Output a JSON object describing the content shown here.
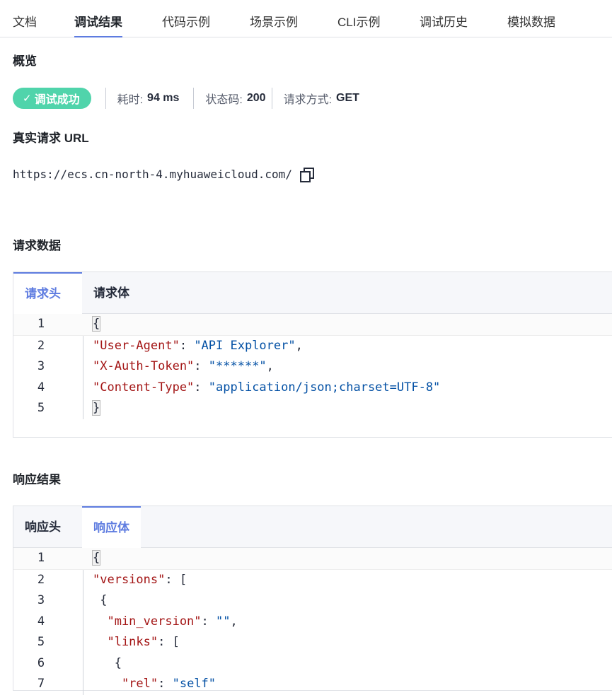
{
  "tabs": [
    "文档",
    "调试结果",
    "代码示例",
    "场景示例",
    "CLI示例",
    "调试历史",
    "模拟数据"
  ],
  "overview": {
    "title": "概览",
    "status": "调试成功",
    "time_label": "耗时:",
    "time_value": "94 ms",
    "code_label": "状态码:",
    "code_value": "200",
    "method_label": "请求方式:",
    "method_value": "GET"
  },
  "url_section": {
    "title": "真实请求 URL",
    "url": "https://ecs.cn-north-4.myhuaweicloud.com/"
  },
  "request": {
    "title": "请求数据",
    "tabs": [
      "请求头",
      "请求体"
    ],
    "active_tab": "请求头",
    "lines": [
      {
        "n": "1",
        "parts": [
          {
            "c": "brace",
            "t": "{"
          }
        ]
      },
      {
        "n": "2",
        "parts": [
          {
            "c": "str",
            "t": "\"User-Agent\""
          },
          {
            "c": "pun",
            "t": ": "
          },
          {
            "c": "val",
            "t": "\"API Explorer\""
          },
          {
            "c": "pun",
            "t": ","
          }
        ]
      },
      {
        "n": "3",
        "parts": [
          {
            "c": "str",
            "t": "\"X-Auth-Token\""
          },
          {
            "c": "pun",
            "t": ": "
          },
          {
            "c": "val",
            "t": "\"******\""
          },
          {
            "c": "pun",
            "t": ","
          }
        ]
      },
      {
        "n": "4",
        "parts": [
          {
            "c": "str",
            "t": "\"Content-Type\""
          },
          {
            "c": "pun",
            "t": ": "
          },
          {
            "c": "val",
            "t": "\"application/json;charset=UTF-8\""
          }
        ]
      },
      {
        "n": "5",
        "parts": [
          {
            "c": "brace",
            "t": "}"
          }
        ]
      }
    ]
  },
  "response": {
    "title": "响应结果",
    "tabs": [
      "响应头",
      "响应体"
    ],
    "active_tab": "响应体",
    "lines": [
      {
        "n": "1",
        "parts": [
          {
            "c": "brace",
            "t": "{"
          }
        ]
      },
      {
        "n": "2",
        "parts": [
          {
            "c": "str",
            "t": "\"versions\""
          },
          {
            "c": "pun",
            "t": ": ["
          }
        ]
      },
      {
        "n": "3",
        "parts": [
          {
            "c": "pun",
            "t": " {"
          }
        ]
      },
      {
        "n": "4",
        "parts": [
          {
            "c": "str",
            "t": "  \"min_version\""
          },
          {
            "c": "pun",
            "t": ": "
          },
          {
            "c": "val",
            "t": "\"\""
          },
          {
            "c": "pun",
            "t": ","
          }
        ]
      },
      {
        "n": "5",
        "parts": [
          {
            "c": "str",
            "t": "  \"links\""
          },
          {
            "c": "pun",
            "t": ": ["
          }
        ]
      },
      {
        "n": "6",
        "parts": [
          {
            "c": "pun",
            "t": "   {"
          }
        ]
      },
      {
        "n": "7",
        "parts": [
          {
            "c": "str",
            "t": "    \"rel\""
          },
          {
            "c": "pun",
            "t": ": "
          },
          {
            "c": "val",
            "t": "\"self\""
          }
        ]
      }
    ]
  }
}
